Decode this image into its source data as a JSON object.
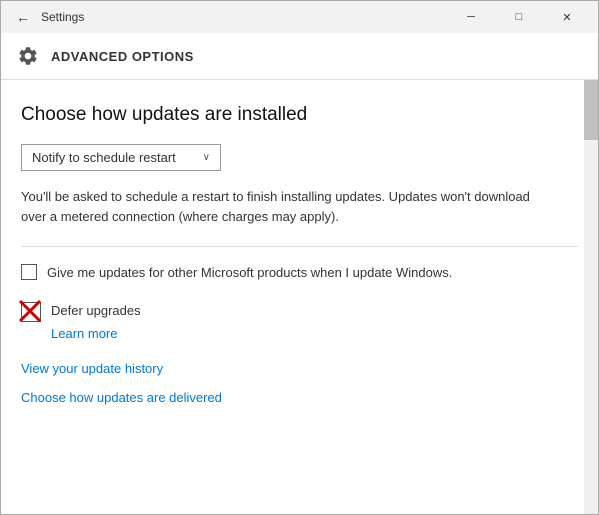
{
  "titleBar": {
    "backLabel": "←",
    "title": "Settings",
    "minimizeLabel": "─",
    "restoreLabel": "□",
    "closeLabel": "✕"
  },
  "header": {
    "gearIcon": "gear-icon",
    "title": "ADVANCED OPTIONS"
  },
  "content": {
    "sectionTitle": "Choose how updates are installed",
    "dropdown": {
      "label": "Notify to schedule restart",
      "arrow": "∨"
    },
    "description": "You'll be asked to schedule a restart to finish installing updates. Updates won't download over a metered connection (where charges may apply).",
    "checkboxRow": {
      "label": "Give me updates for other Microsoft products when I update Windows."
    },
    "deferRow": {
      "label": "Defer upgrades"
    },
    "learnMore": "Learn more",
    "links": [
      "View your update history",
      "Choose how updates are delivered"
    ]
  }
}
